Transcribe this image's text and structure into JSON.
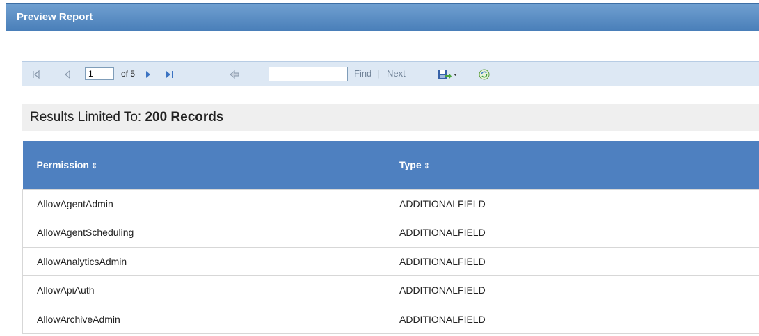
{
  "window": {
    "title": "Preview Report"
  },
  "toolbar": {
    "first_icon": "first-page-icon",
    "prev_icon": "previous-page-icon",
    "current_page": "1",
    "page_count_text": "of 5",
    "next_icon": "next-page-icon",
    "last_icon": "last-page-icon",
    "back_icon": "back-to-parent-icon",
    "find_value": "",
    "find_label": "Find",
    "separator": "|",
    "next_label": "Next",
    "export_icon": "save-export-icon",
    "refresh_icon": "refresh-icon"
  },
  "results": {
    "prefix": "Results Limited To:",
    "limit": "200 Records"
  },
  "table": {
    "columns": [
      "Permission",
      "Type"
    ],
    "rows": [
      [
        "AllowAgentAdmin",
        "ADDITIONALFIELD"
      ],
      [
        "AllowAgentScheduling",
        "ADDITIONALFIELD"
      ],
      [
        "AllowAnalyticsAdmin",
        "ADDITIONALFIELD"
      ],
      [
        "AllowApiAuth",
        "ADDITIONALFIELD"
      ],
      [
        "AllowArchiveAdmin",
        "ADDITIONALFIELD"
      ]
    ]
  },
  "colors": {
    "titlebar": "#4a7fb9",
    "header": "#4e80c0",
    "toolbar": "#dde8f4",
    "results_bar": "#efefef"
  }
}
